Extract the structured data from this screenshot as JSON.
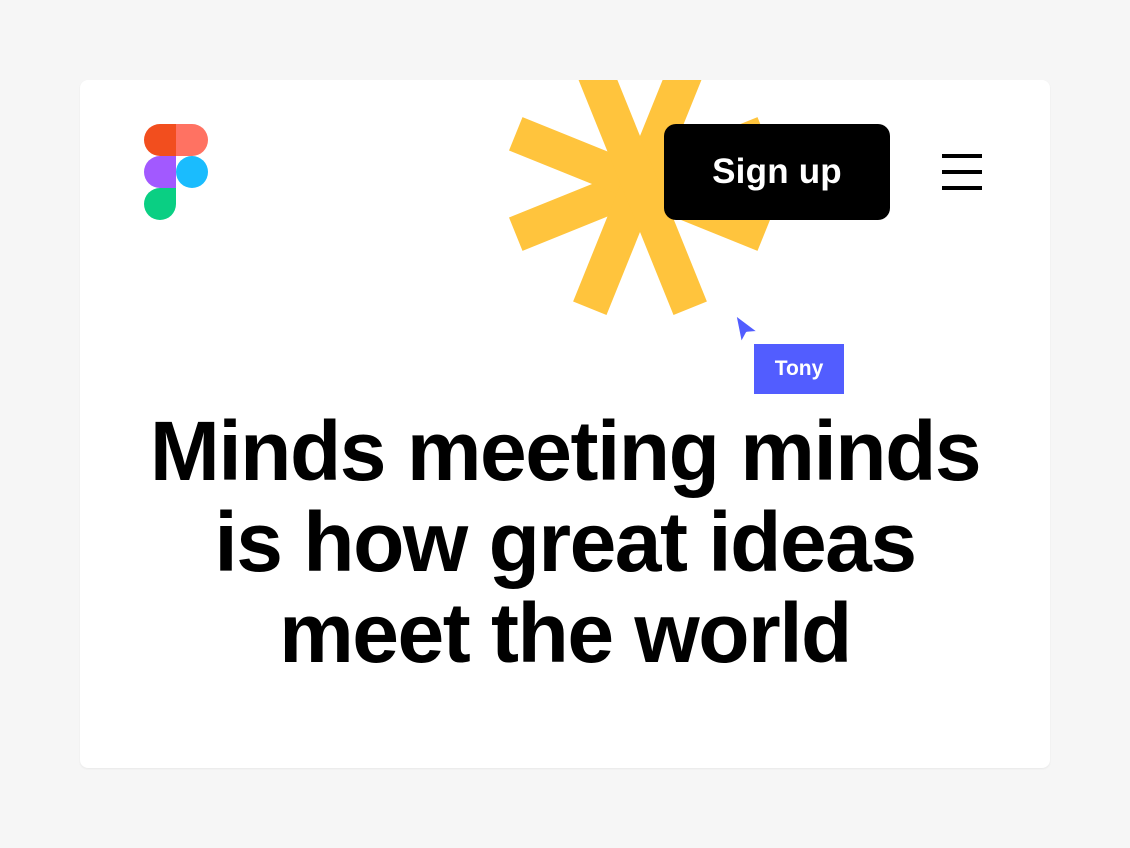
{
  "header": {
    "logo_icon": "figma-logo-icon",
    "signup_label": "Sign up",
    "menu_icon": "hamburger-menu-icon"
  },
  "decoration": {
    "asterisk_color": "#ffc43d"
  },
  "collaborator": {
    "name": "Tony",
    "cursor_color": "#525dff"
  },
  "hero": {
    "line1": "Minds meeting minds",
    "line2": "is how great ideas",
    "line3": "meet the world"
  },
  "colors": {
    "background": "#f6f6f6",
    "card": "#ffffff",
    "button": "#000000",
    "logo_red": "#f24e1e",
    "logo_coral": "#ff7262",
    "logo_purple": "#a259ff",
    "logo_blue": "#1abcfe",
    "logo_green": "#0acf83"
  }
}
